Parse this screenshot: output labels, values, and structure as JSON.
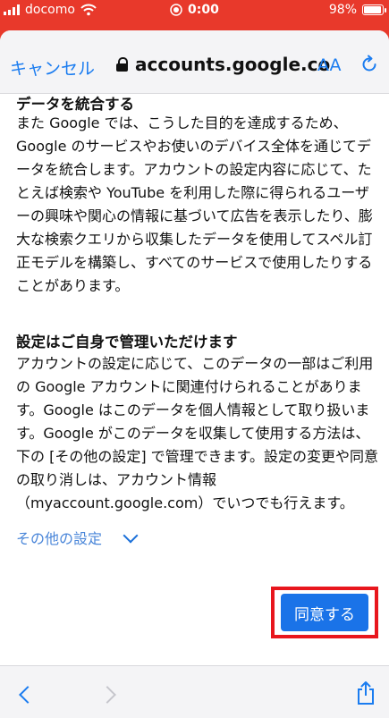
{
  "status_bar": {
    "carrier": "docomo",
    "time": "0:00",
    "battery": "98%",
    "battery_level": 0.98,
    "color": "#e8392b"
  },
  "toolbar": {
    "cancel_label": "キャンセル",
    "url": "accounts.google.co",
    "text_size_label": "AA",
    "icons": [
      "lock-icon",
      "reload-icon"
    ]
  },
  "content": {
    "sections": [
      {
        "title": "データを統合する",
        "body": "また Google では、こうした目的を達成するため、Google のサービスやお使いのデバイス全体を通じてデータを統合します。アカウントの設定内容に応じて、たとえば検索や YouTube を利用した際に得られるユーザーの興味や関心の情報に基づいて広告を表示したり、膨大な検索クエリから収集したデータを使用してスペル訂正モデルを構築し、すべてのサービスで使用したりすることがあります。"
      },
      {
        "title": "設定はご自身で管理いただけます",
        "body": "アカウントの設定に応じて、このデータの一部はご利用の Google アカウントに関連付けられることがあります。Google はこのデータを個人情報として取り扱います。Google がこのデータを収集して使用する方法は、下の [その他の設定] で管理できます。設定の変更や同意の取り消しは、アカウント情報（myaccount.google.com）でいつでも行えます。"
      }
    ],
    "more_settings_label": "その他の設定",
    "agree_button_label": "同意する",
    "accent_color": "#1a73e8",
    "highlight_color": "#e8161d"
  },
  "bottom_bar": {
    "icons": [
      "back-icon",
      "forward-icon",
      "share-icon"
    ]
  }
}
